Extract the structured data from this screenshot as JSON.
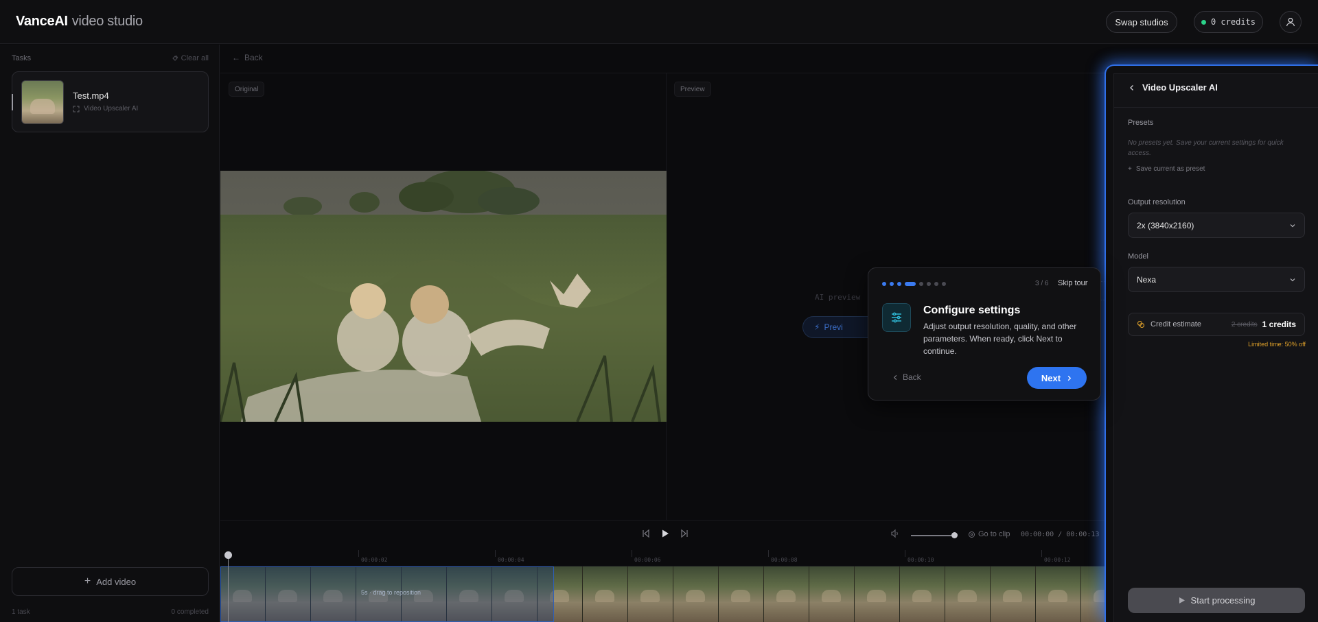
{
  "app": {
    "brand_bold": "VanceAI",
    "brand_light": "video studio",
    "swap_label": "Swap studios",
    "credits_label": "0 credits",
    "accent_color": "#2f6fe8",
    "credit_dot_color": "#2bd38a"
  },
  "sidebar": {
    "tasks_label": "Tasks",
    "clear_all_label": "Clear all",
    "task": {
      "name": "Test.mp4",
      "tool": "Video Upscaler AI"
    },
    "add_video_label": "Add video",
    "footer_left": "1 task",
    "footer_right": "0 completed"
  },
  "workspace": {
    "back_label": "Back",
    "original_tag": "Original",
    "preview_tag": "Preview",
    "ai_preview_text": "AI preview",
    "preview_button_label": "Previ",
    "goto_clip_label": "Go to clip",
    "timecode": "00:00:00 / 00:00:13",
    "volume_fraction": 0.95,
    "ruler_ticks": [
      "00:00:02",
      "00:00:04",
      "00:00:06",
      "00:00:08",
      "00:00:10",
      "00:00:12"
    ],
    "drag_hint": "5s · drag to reposition"
  },
  "panel": {
    "title": "Video Upscaler AI",
    "presets_label": "Presets",
    "presets_note": "No presets yet. Save your current settings for quick access.",
    "save_preset_label": "Save current as preset",
    "output_resolution_label": "Output resolution",
    "output_resolution_value": "2x (3840x2160)",
    "model_label": "Model",
    "model_value": "Nexa",
    "estimate_label": "Credit estimate",
    "estimate_old": "2 credits",
    "estimate_new": "1 credits",
    "limited_label": "Limited time: 50% off",
    "start_label": "Start processing"
  },
  "tour": {
    "step_count": "3 / 6",
    "current_step": 3,
    "total_steps": 6,
    "skip_label": "Skip tour",
    "title": "Configure settings",
    "body": "Adjust output resolution, quality, and other parameters. When ready, click Next to continue.",
    "back_label": "Back",
    "next_label": "Next"
  }
}
